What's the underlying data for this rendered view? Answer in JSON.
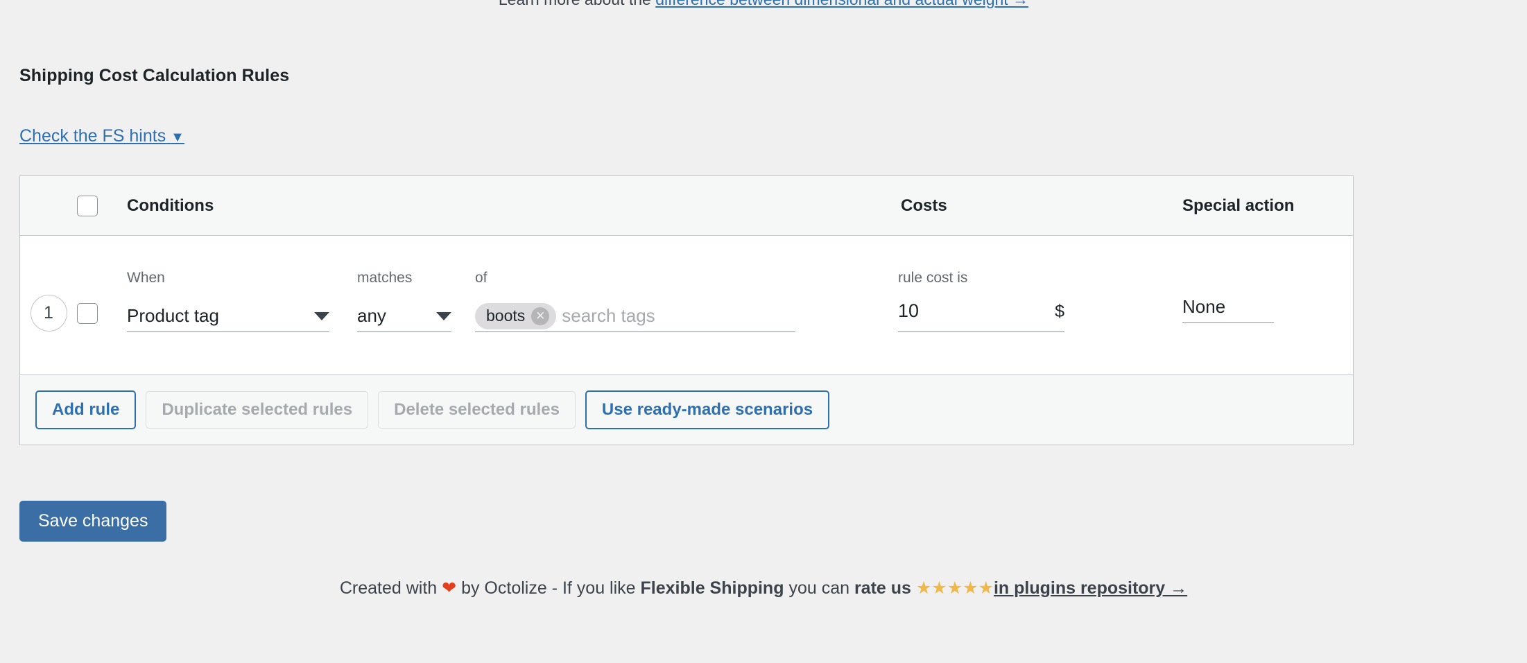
{
  "top_notice": {
    "text_before": "Learn more about the ",
    "link_text": "difference between dimensional and actual weight →"
  },
  "section": {
    "title": "Shipping Cost Calculation Rules",
    "hints_link": "Check the FS hints",
    "hints_caret": "▼"
  },
  "table": {
    "headers": {
      "conditions": "Conditions",
      "costs": "Costs",
      "special_action": "Special action"
    },
    "rows": [
      {
        "number": "1",
        "when_label": "When",
        "when_value": "Product tag",
        "matches_label": "matches",
        "matches_value": "any",
        "of_label": "of",
        "tags": [
          "boots"
        ],
        "tags_placeholder": "search tags",
        "cost_label": "rule cost is",
        "cost_value": "10",
        "cost_unit": "$",
        "special_action_value": "None"
      }
    ],
    "actions": [
      {
        "label": "Add rule",
        "state": "enabled"
      },
      {
        "label": "Duplicate selected rules",
        "state": "disabled"
      },
      {
        "label": "Delete selected rules",
        "state": "disabled"
      },
      {
        "label": "Use ready-made scenarios",
        "state": "enabled"
      }
    ]
  },
  "save_button": "Save changes",
  "footer": {
    "created_with": "Created with",
    "heart": "❤",
    "by": "by Octolize - If you like",
    "product": "Flexible Shipping",
    "you_can": "you can",
    "rate_us": "rate us",
    "stars": "★★★★★",
    "repo_link": "in plugins repository →"
  },
  "colors": {
    "accent_blue": "#2e6fb0",
    "save_blue": "#3a6ea5",
    "star_gold": "#f0b849",
    "heart_red": "#e2401c",
    "page_bg": "#f0f0f1",
    "header_bg": "#f6f7f7",
    "border": "#c3c4c7"
  }
}
